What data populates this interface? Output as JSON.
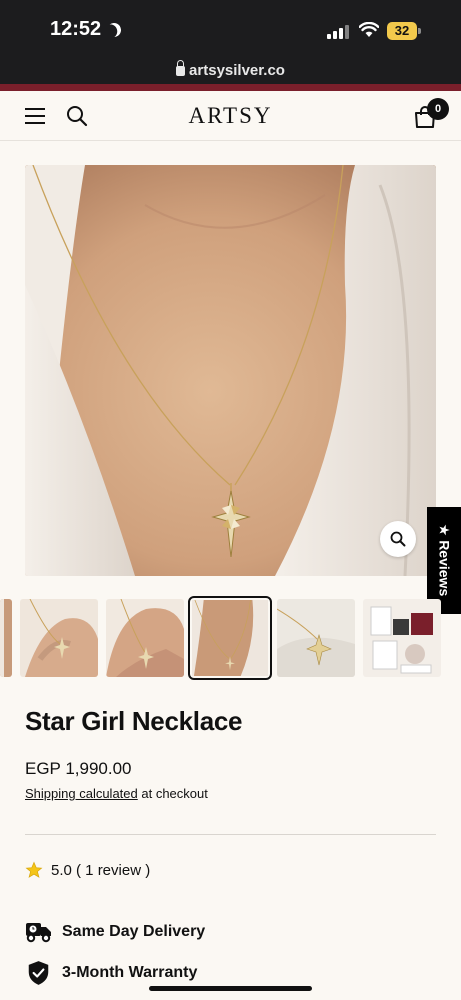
{
  "status_bar": {
    "time": "12:52",
    "battery": "32"
  },
  "browser": {
    "url": "artsysilver.co"
  },
  "header": {
    "brand": "ARTSY",
    "cart_count": "0"
  },
  "reviews_tab": {
    "label": "★ Reviews"
  },
  "product": {
    "title": "Star Girl Necklace",
    "price": "EGP 1,990.00",
    "shipping_link": "Shipping calculated",
    "shipping_suffix": " at checkout",
    "rating_text": "5.0 ( 1 review )"
  },
  "features": [
    {
      "label": "Same Day Delivery",
      "icon": "delivery-truck-icon"
    },
    {
      "label": "3-Month Warranty",
      "icon": "shield-check-icon"
    }
  ],
  "thumbnails": [
    {
      "name": "partial-left"
    },
    {
      "name": "hand-ring"
    },
    {
      "name": "hand-pendant"
    },
    {
      "name": "neck-pendant",
      "selected": true
    },
    {
      "name": "pendant-on-fabric"
    },
    {
      "name": "packaging"
    }
  ],
  "colors": {
    "accent": "#7a1f2b",
    "background": "#fbf8f3",
    "gold": "#d4b26a"
  }
}
